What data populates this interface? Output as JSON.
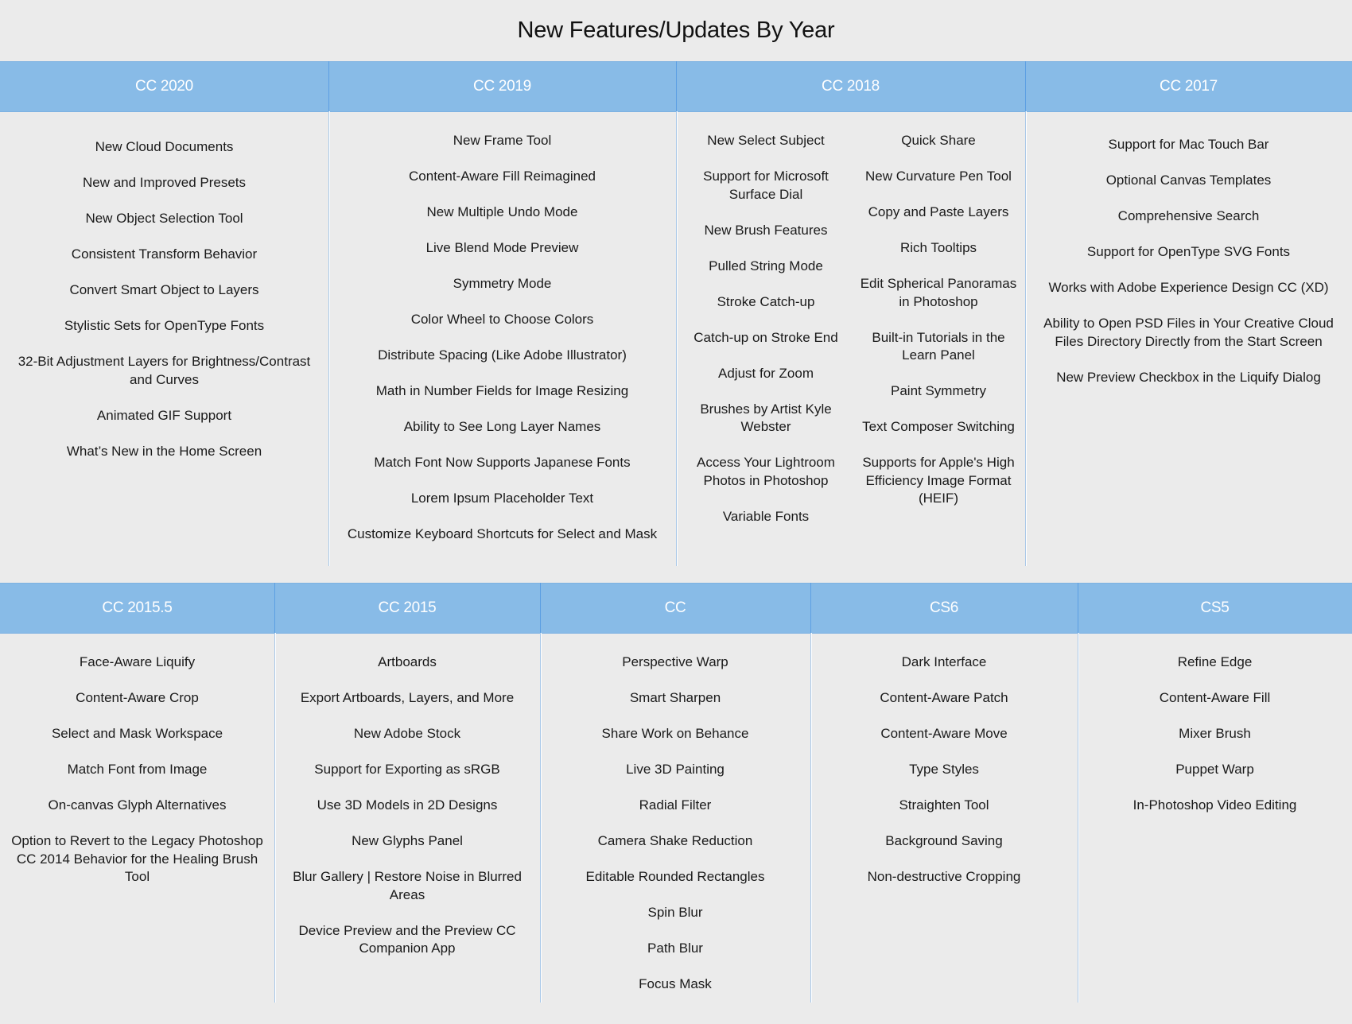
{
  "title": "New Features/Updates By Year",
  "top_row": [
    {
      "version": "CC 2020",
      "features": [
        "New Cloud Documents",
        "New and Improved Presets",
        "New Object Selection Tool",
        "Consistent Transform Behavior",
        "Convert Smart Object to Layers",
        "Stylistic Sets for OpenType Fonts",
        "32-Bit Adjustment Layers for Brightness/Contrast and Curves",
        "Animated GIF Support",
        "What’s New in the Home Screen"
      ]
    },
    {
      "version": "CC 2019",
      "features": [
        "New Frame Tool",
        "Content-Aware Fill Reimagined",
        "New Multiple Undo Mode",
        "Live Blend Mode Preview",
        "Symmetry Mode",
        "Color Wheel to Choose Colors",
        "Distribute Spacing (Like Adobe Illustrator)",
        "Math in Number Fields for Image Resizing",
        "Ability to See Long Layer Names",
        "Match Font Now Supports Japanese Fonts",
        "Lorem Ipsum Placeholder Text",
        "Customize Keyboard Shortcuts for Select and Mask"
      ]
    },
    {
      "version": "CC 2018",
      "features_left": [
        "New Select Subject",
        "Support for Microsoft Surface Dial",
        "New Brush Features",
        "Pulled String Mode",
        "Stroke Catch-up",
        "Catch-up on Stroke End",
        "Adjust for Zoom",
        "Brushes by Artist Kyle Webster",
        "Access Your Lightroom Photos in Photoshop",
        "Variable Fonts"
      ],
      "features_right": [
        "Quick Share",
        "New Curvature Pen Tool",
        "Copy and Paste Layers",
        "Rich Tooltips",
        "Edit Spherical Panoramas in Photoshop",
        "Built-in Tutorials in the Learn Panel",
        "Paint Symmetry",
        "Text Composer Switching",
        "Supports for Apple's High Efficiency Image Format (HEIF)"
      ]
    },
    {
      "version": "CC 2017",
      "features": [
        "Support for Mac Touch Bar",
        "Optional Canvas Templates",
        "Comprehensive Search",
        "Support for OpenType SVG Fonts",
        "Works with Adobe Experience Design CC (XD)",
        "Ability to Open PSD Files in Your Creative Cloud Files Directory Directly from the Start Screen",
        "New Preview Checkbox in the Liquify Dialog"
      ]
    }
  ],
  "bottom_row": [
    {
      "version": "CC 2015.5",
      "features": [
        "Face-Aware Liquify",
        "Content-Aware Crop",
        "Select and Mask Workspace",
        "Match Font from Image",
        "On-canvas Glyph Alternatives",
        "Option to Revert to the Legacy Photoshop CC 2014 Behavior for the Healing Brush Tool"
      ]
    },
    {
      "version": "CC 2015",
      "features": [
        "Artboards",
        "Export Artboards, Layers, and More",
        "New Adobe Stock",
        "Support for Exporting as sRGB",
        "Use 3D Models in 2D Designs",
        "New Glyphs Panel",
        "Blur Gallery | Restore Noise in Blurred Areas",
        "Device Preview and the Preview CC Companion App"
      ]
    },
    {
      "version": "CC",
      "features": [
        "Perspective Warp",
        "Smart Sharpen",
        "Share Work on Behance",
        "Live 3D Painting",
        "Radial Filter",
        "Camera Shake Reduction",
        "Editable Rounded Rectangles",
        "Spin Blur",
        "Path Blur",
        "Focus Mask"
      ]
    },
    {
      "version": "CS6",
      "features": [
        "Dark Interface",
        "Content-Aware Patch",
        "Content-Aware Move",
        "Type Styles",
        "Straighten Tool",
        "Background Saving",
        "Non-destructive Cropping"
      ]
    },
    {
      "version": "CS5",
      "features": [
        "Refine Edge",
        "Content-Aware Fill",
        "Mixer Brush",
        "Puppet Warp",
        "In-Photoshop Video Editing"
      ]
    }
  ],
  "colors": {
    "background": "#ebebeb",
    "header": "#88bbe7",
    "header_text": "#ffffff",
    "divider_top": "#5c9fe3",
    "divider_bottom": "#a9c8e8"
  }
}
